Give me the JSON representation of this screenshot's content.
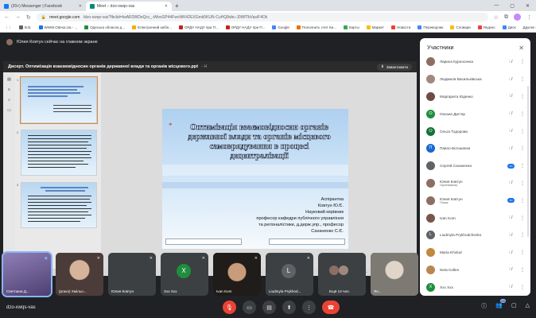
{
  "browser": {
    "tabs": [
      {
        "label": "(20+) Messenger | Facebook",
        "color": "#1877f2"
      },
      {
        "label": "Meet – dzo-xwqs-vas",
        "color": "#00897b"
      }
    ],
    "url_domain": "meet.google.com",
    "url_path": "/dzo-xwqs-vas?fbclid=IwAR3WDeQcc_-tMvvGP44FwvWK42EXGmk5KUN-CuHQ8sbc-J0WfTbVasiF4Ok",
    "bookmarks": [
      "B.B.",
      "WWW.Odesa.Ua - ...",
      "Одеська обласна д...",
      "Електронний кабін...",
      "ОРДУ НАДУ при П...",
      "ОРДУ НАДУ при П...",
      "Google",
      "Пополнить счет Ки...",
      "Карты",
      "Маркет",
      "Новости",
      "Переводчик",
      "Словари",
      "Яндекс",
      "Диск"
    ],
    "bookmarks_right": "Другие закладки"
  },
  "meet": {
    "presenter_label": "Юлия Ковтун сейчас на главном экране",
    "share_title": "Дисерт. Оптимізація взаємовідносин органів державної влади та органів місцевого.ppt",
    "share_title_dim": "- Н",
    "download_label": "Завантажити",
    "slide": {
      "title": "Оптимізація взаємовідносин органів державної влади та органів місцевого самоврядування в процесі децентралізації",
      "sub_lines": [
        "Аспірантка",
        "Ковтун Ю.Є.",
        "Науковий керівник",
        "професор кафедри публічного управління",
        "та регіоналістики, д.держ.упр., професор",
        "Саханенко С.Є."
      ]
    },
    "thumbs": [
      {
        "num": "1"
      },
      {
        "num": "2"
      },
      {
        "num": "3"
      }
    ],
    "status_left": "Слайд 1 з 17",
    "status_zoom": "Масштаб 85%",
    "strip": [
      {
        "name": "Светлана Д...",
        "type": "photo",
        "color": "#6b5a8f"
      },
      {
        "name": "(pravo) Хмільо...",
        "type": "photo",
        "color": "#5a4a48"
      },
      {
        "name": "Юлия Ковтун",
        "type": "dark",
        "color": "#3c4043"
      },
      {
        "name": "Ххх Ххх",
        "type": "letter",
        "letter": "X",
        "color": "#1e8e3e"
      },
      {
        "name": "Ivan Kom",
        "type": "photo",
        "color": "#2d2a26"
      },
      {
        "name": "Liudmyla Prykhod...",
        "type": "letter",
        "letter": "L",
        "color": "#5f6368"
      },
      {
        "name": "Ещё 14 чел.",
        "type": "more",
        "color": "#3c4043"
      },
      {
        "name": "Ян...",
        "type": "photo",
        "color": "#7d7a74"
      }
    ],
    "meeting_code": "dzo-xwqs-vas",
    "participant_count": "28"
  },
  "panel": {
    "title": "Участники",
    "people": [
      {
        "name": "Лариса Курносенко",
        "role": "",
        "color": "#8d6e63",
        "letter": ""
      },
      {
        "name": "Людмила Васильківська",
        "role": "",
        "color": "#a1887f",
        "letter": ""
      },
      {
        "name": "Маргарита Юденко",
        "role": "",
        "color": "#6d4c41",
        "letter": ""
      },
      {
        "name": "Оксана Дигтяр",
        "role": "",
        "color": "#1e8e3e",
        "letter": "О"
      },
      {
        "name": "Ольга Тодорова",
        "role": "",
        "color": "#137333",
        "letter": "О"
      },
      {
        "name": "Павло Білошапка",
        "role": "",
        "color": "#1967d2",
        "letter": "П"
      },
      {
        "name": "Сергей Саханенко",
        "role": "",
        "color": "#5f6368",
        "letter": ""
      },
      {
        "name": "Юлия Ковтун",
        "role": "Организатор",
        "color": "#8d6e63",
        "letter": ""
      },
      {
        "name": "Юлия Ковтун",
        "role": "Показ",
        "color": "#8d6e63",
        "letter": ""
      },
      {
        "name": "Ivan Kom",
        "role": "",
        "color": "#795548",
        "letter": ""
      },
      {
        "name": "Liudmyla Prykhodchenko",
        "role": "",
        "color": "#5f6368",
        "letter": "L"
      },
      {
        "name": "Maria Kholod",
        "role": "",
        "color": "#c0893b",
        "letter": ""
      },
      {
        "name": "Neta Kollen",
        "role": "",
        "color": "#b88750",
        "letter": ""
      },
      {
        "name": "Ххх Ххх",
        "role": "",
        "color": "#1e8e3e",
        "letter": "X"
      }
    ]
  }
}
